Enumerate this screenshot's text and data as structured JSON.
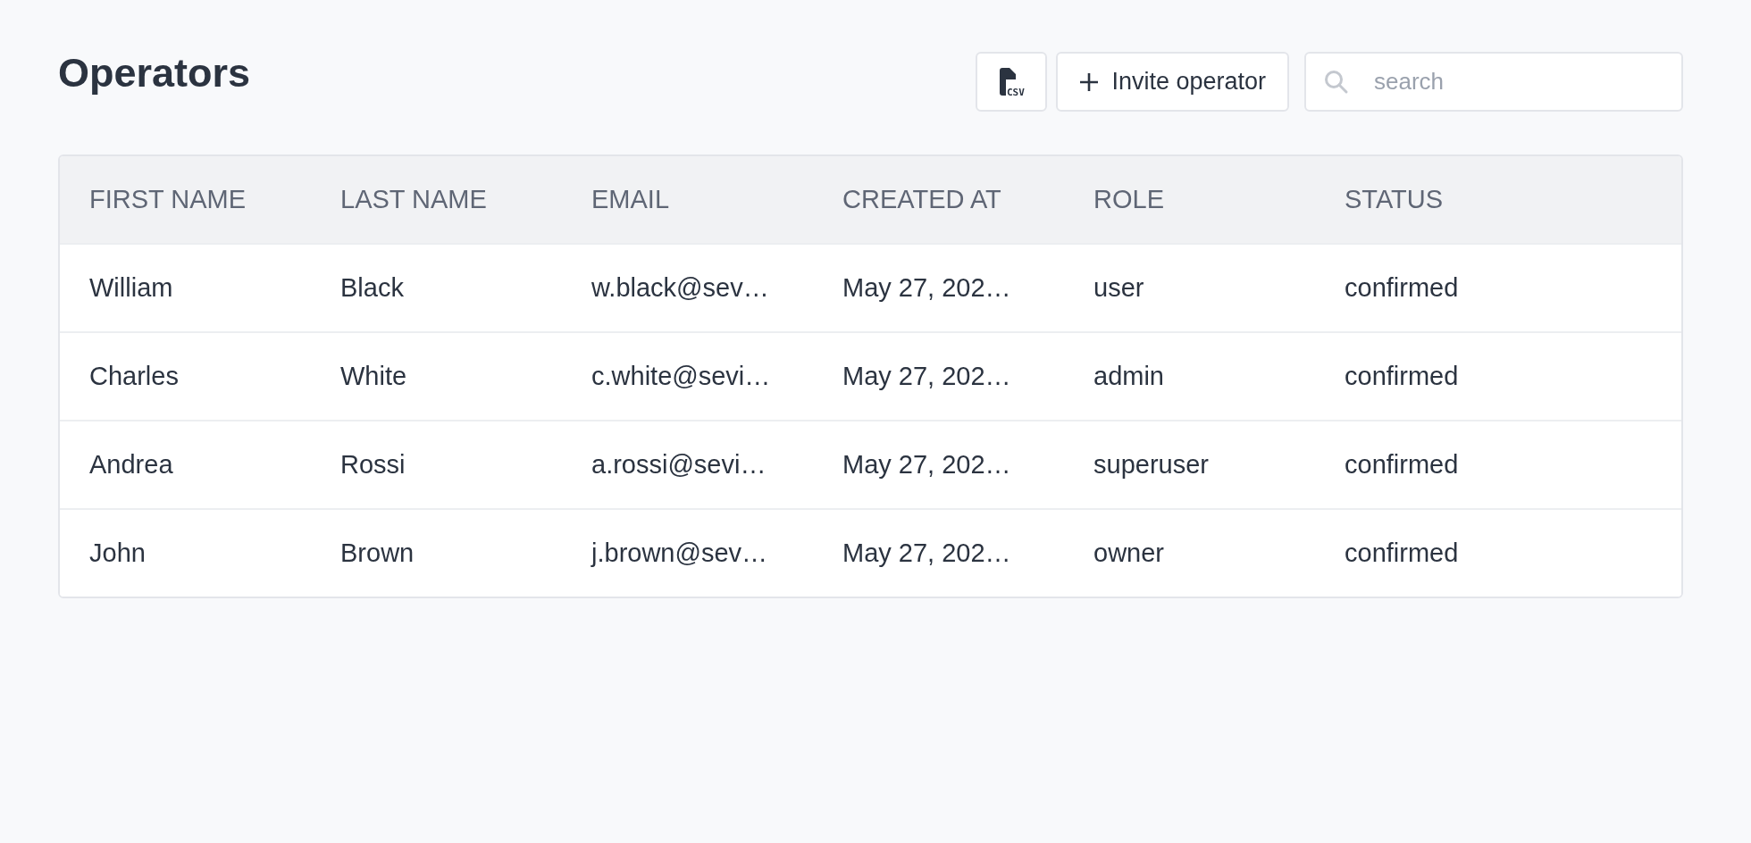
{
  "title": "Operators",
  "toolbar": {
    "csv_icon_label": "CSV",
    "invite_button": "Invite operator",
    "search": {
      "placeholder": "search"
    }
  },
  "table": {
    "columns": [
      "FIRST NAME",
      "LAST NAME",
      "EMAIL",
      "CREATED AT",
      "ROLE",
      "STATUS"
    ],
    "rows": [
      [
        "William",
        "Black",
        "w.black@sev…",
        "May 27, 202…",
        "user",
        "confirmed"
      ],
      [
        "Charles",
        "White",
        "c.white@sevi…",
        "May 27, 202…",
        "admin",
        "confirmed"
      ],
      [
        "Andrea",
        "Rossi",
        "a.rossi@sevi…",
        "May 27, 202…",
        "superuser",
        "confirmed"
      ],
      [
        "John",
        "Brown",
        "j.brown@sev…",
        "May 27, 202…",
        "owner",
        "confirmed"
      ]
    ]
  }
}
